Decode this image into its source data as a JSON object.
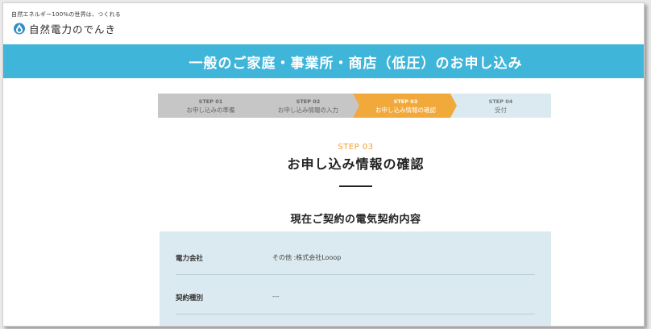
{
  "header": {
    "tagline": "自然エネルギー100%の世界は、つくれる",
    "logo_text": "自然電力のでんき",
    "logo_icon": "water-drop-icon",
    "logo_color": "#2f8fc7"
  },
  "banner": {
    "title": "一般のご家庭・事業所・商店（低圧）のお申し込み",
    "color": "#3fb5d9"
  },
  "steps": [
    {
      "num": "STEP 01",
      "label": "お申し込みの準備",
      "state": "done"
    },
    {
      "num": "STEP 02",
      "label": "お申し込み情報の入力",
      "state": "done"
    },
    {
      "num": "STEP 03",
      "label": "お申し込み情報の確認",
      "state": "active"
    },
    {
      "num": "STEP 04",
      "label": "受付",
      "state": "todo"
    }
  ],
  "main": {
    "step_kicker": "STEP 03",
    "title": "お申し込み情報の確認",
    "subtitle": "現在ご契約の電気契約内容",
    "accent_color": "#f2a93b"
  },
  "contract": {
    "rows": [
      {
        "key": "電力会社",
        "value": "その他 :株式会社Looop"
      },
      {
        "key": "契約種別",
        "value": "---"
      }
    ]
  }
}
